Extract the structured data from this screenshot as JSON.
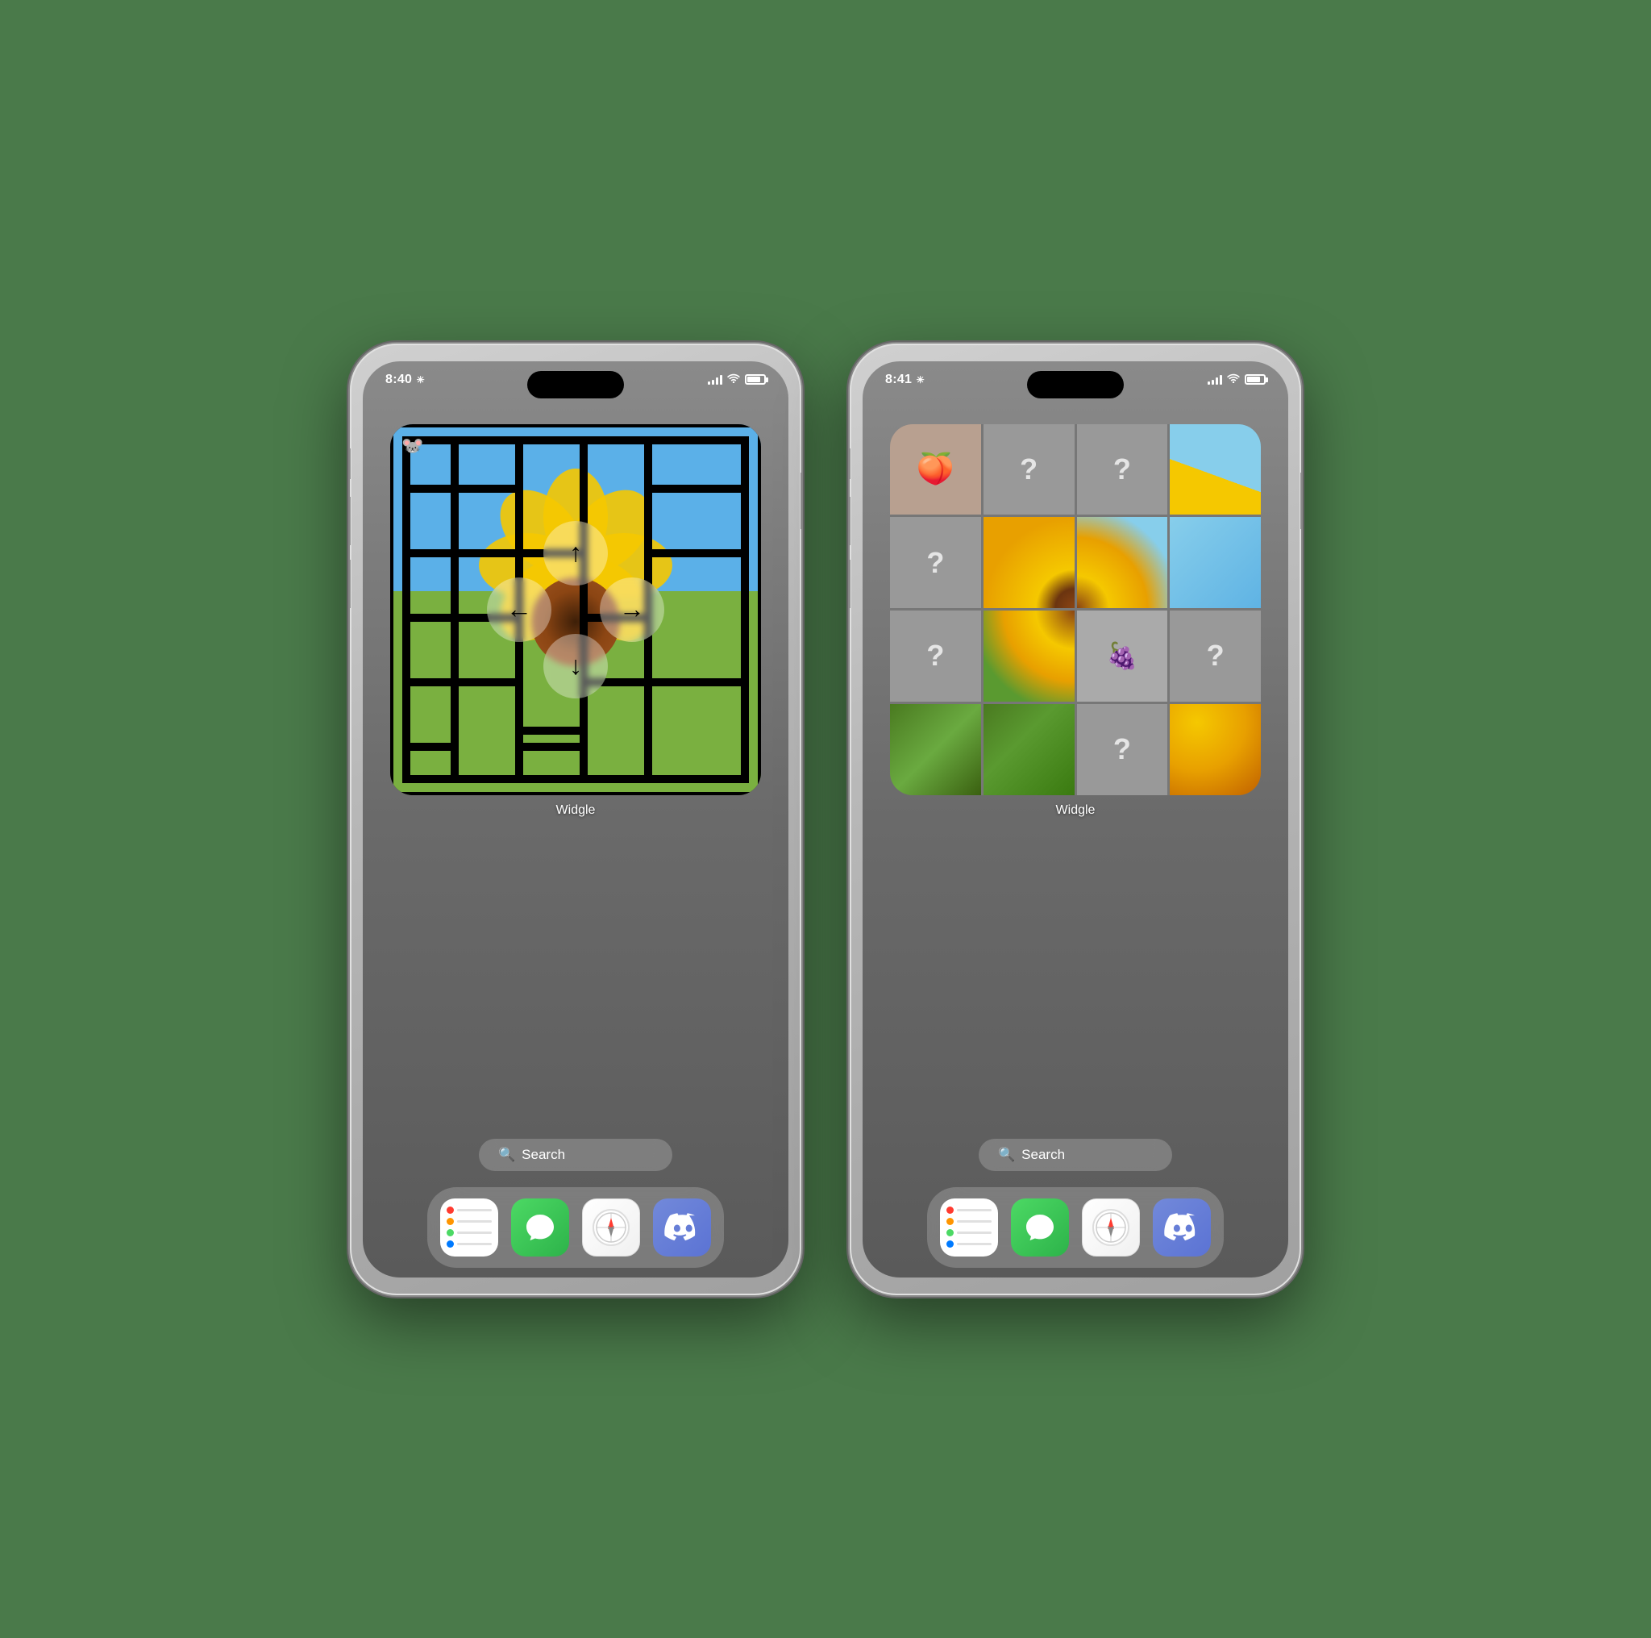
{
  "phones": [
    {
      "id": "phone-left",
      "status": {
        "time": "8:40",
        "sun_icon": "☀",
        "signal": 3,
        "wifi": true,
        "battery": 80
      },
      "widget": {
        "type": "maze",
        "label": "Widgle",
        "mouse_icon": "🐭"
      },
      "search": {
        "label": "Search",
        "icon": "🔍"
      },
      "dock": [
        {
          "name": "Reminders",
          "type": "reminders"
        },
        {
          "name": "Messages",
          "type": "messages"
        },
        {
          "name": "Safari",
          "type": "safari"
        },
        {
          "name": "Discord",
          "type": "discord"
        }
      ]
    },
    {
      "id": "phone-right",
      "status": {
        "time": "8:41",
        "sun_icon": "☀",
        "signal": 3,
        "wifi": true,
        "battery": 80
      },
      "widget": {
        "type": "puzzle",
        "label": "Widgle",
        "cells": [
          {
            "type": "peach",
            "emoji": "🍑"
          },
          {
            "type": "mystery"
          },
          {
            "type": "mystery"
          },
          {
            "type": "sky-corner"
          },
          {
            "type": "mystery"
          },
          {
            "type": "sf-tl"
          },
          {
            "type": "sf-tr"
          },
          {
            "type": "sky"
          },
          {
            "type": "mystery"
          },
          {
            "type": "sf-bl"
          },
          {
            "type": "grape",
            "emoji": "🍇"
          },
          {
            "type": "mystery"
          },
          {
            "type": "sf-bottom-l"
          },
          {
            "type": "sf-bottom-m"
          },
          {
            "type": "mystery"
          },
          {
            "type": "sf-yellow"
          }
        ]
      },
      "search": {
        "label": "Search",
        "icon": "🔍"
      },
      "dock": [
        {
          "name": "Reminders",
          "type": "reminders"
        },
        {
          "name": "Messages",
          "type": "messages"
        },
        {
          "name": "Safari",
          "type": "safari"
        },
        {
          "name": "Discord",
          "type": "discord"
        }
      ]
    }
  ],
  "labels": {
    "widgle": "Widgle",
    "search": "Search"
  }
}
